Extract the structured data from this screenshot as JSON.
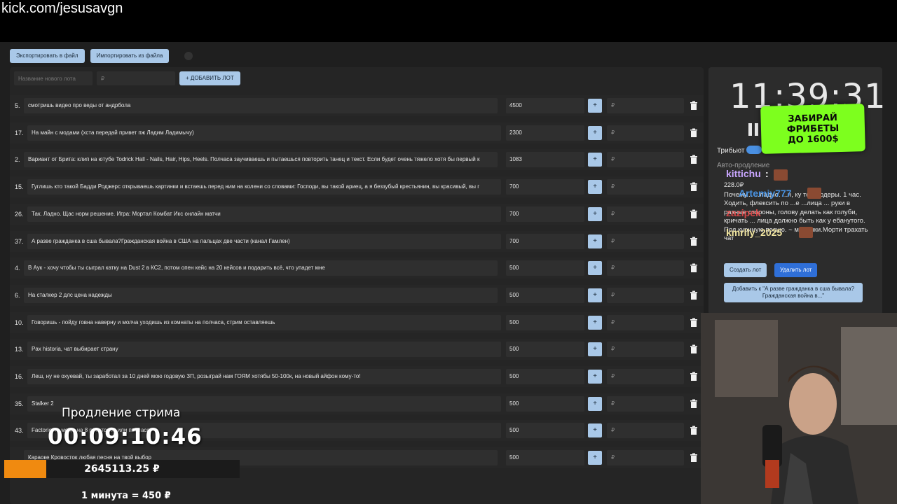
{
  "url": "kick.com/jesusavgn",
  "toolbar": {
    "export_label": "Экспортировать в файл",
    "import_label": "Импортировать из файла"
  },
  "new_lot": {
    "name_placeholder": "Название нового лота",
    "amount_placeholder": "₽",
    "add_label": "+ ДОБАВИТЬ ЛОТ"
  },
  "lots": [
    {
      "num": "5.",
      "title": "смотришь видео про веды от андрбола",
      "amount": "4500"
    },
    {
      "num": "17.",
      "title": "На майн с модами (хста передай привет пж Ладим Ладимычу)",
      "amount": "2300"
    },
    {
      "num": "2.",
      "title": "Вариант от Брита: клип на ютубе Todrick Hall - Nails, Hair, Hips, Heels. Полчаса заучиваешь и пытаешься повторить танец и текст. Если будет очень тяжело хотя бы первый к",
      "amount": "1083"
    },
    {
      "num": "15.",
      "title": "Гуглишь кто такой Бадди Роджерс открываешь картинки и встаешь перед ним на колени со словами: Господи, вы такой ариец, а я беззубый крестьянин, вы красивый, вы г",
      "amount": "700"
    },
    {
      "num": "26.",
      "title": "Так. Ладно. Щас норм решение. Игра: Мортал Комбат Икс онлайн матчи",
      "amount": "700"
    },
    {
      "num": "37.",
      "title": "А разве гражданка в сша бывала?Гражданская война в США на пальцах две части (канал Гамлен)",
      "amount": "700"
    },
    {
      "num": "4.",
      "title": "В Аук - хочу чтобы ты сыграл катку на Dust 2 в КС2, потом опен кейс на 20 кейсов и подарить всё, что упадет мне",
      "amount": "500"
    },
    {
      "num": "6.",
      "title": "На сталкер 2 длс цена надежды",
      "amount": "500"
    },
    {
      "num": "10.",
      "title": "Говоришь - пойду говна наверну и молча уходишь из комнаты на полчаса, стрим оставляешь",
      "amount": "500"
    },
    {
      "num": "13.",
      "title": "Pax historia, чат выбирает страну",
      "amount": "500"
    },
    {
      "num": "16.",
      "title": "Леш, ну не охуевай, ты заработал за 10 дней мою годовую ЗП, розыграй нам ГОЯМ хотябы 50-100к, на новый айфон кому-то!",
      "amount": "500"
    },
    {
      "num": "35.",
      "title": "Stalker 2",
      "amount": "500"
    },
    {
      "num": "43.",
      "title": "Factorio на моды на 8 реакторов или полчаса",
      "amount": "500"
    },
    {
      "num": "",
      "title": "Караоке Кровосток любая песня на твой выбор",
      "amount": "500"
    }
  ],
  "row_add_placeholder": "₽",
  "timer_panel": {
    "clock": "11:39:31",
    "tribute_label": "Трибьют",
    "auto_extend_label": "Авто-продление",
    "donation_amount": "228.0₽",
    "donation_text": "Почему... ...ладно. ...ч, ку топ модеры. 1 час. Ходить, флексить по ...е ...лица ... руки в разные стороны, голову делать как голуби, кричать ... лица должно быть как у ебанутого. Под куриную песню. ~ мамочки.Морти трахать чат",
    "create_lot_label": "Создать лот",
    "delete_lot_label": "Удалить лот",
    "add_to_label": "Добавить к \"А разве гражданка в сша бывала? Гражданская война в...\""
  },
  "promo": {
    "line1": "ЗАБИРАЙ",
    "line2": "ФРИБЕТЫ",
    "line3": "ДО 1600$"
  },
  "chat": {
    "user1": "kittichu",
    "user1_suffix": ":",
    "user2": "Artemiy777",
    "user3": "zazipek",
    "user4": "kmrlly_2025"
  },
  "overlay": {
    "title": "Продление стрима",
    "timer": "00:09:10:46",
    "total": "2645113.25 ₽",
    "rate": "1 минута = 450 ₽",
    "progress_fraction": 0.18
  },
  "colors": {
    "accent_light": "#a9c8e8",
    "accent_blue": "#2f6fd8",
    "promo_green": "#7dff1e",
    "progress_orange": "#f08a10"
  }
}
